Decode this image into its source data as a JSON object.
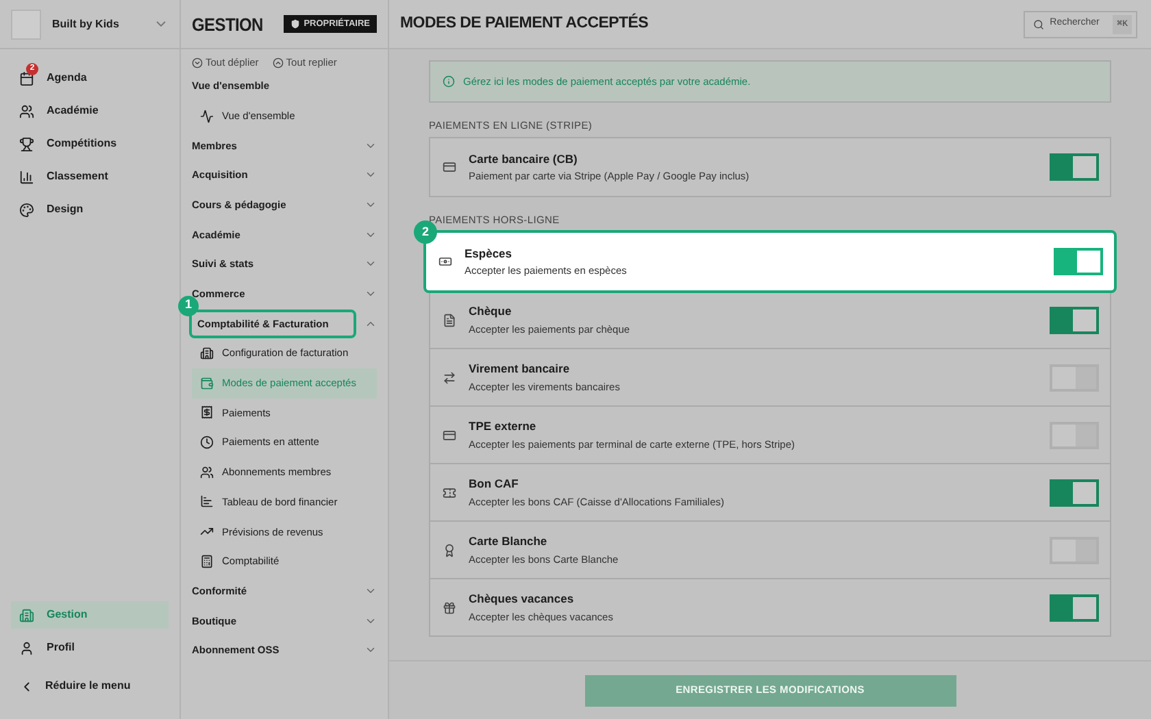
{
  "app_nav": {
    "workspace": "Built by Kids",
    "items": [
      {
        "label": "Agenda",
        "badge": "2",
        "selected": false
      },
      {
        "label": "Académie",
        "selected": false
      },
      {
        "label": "Compétitions",
        "selected": false
      },
      {
        "label": "Classement",
        "selected": false
      },
      {
        "label": "Design",
        "selected": false
      }
    ],
    "bottom_items": [
      {
        "label": "Gestion",
        "selected": true
      },
      {
        "label": "Profil",
        "selected": false
      }
    ],
    "collapse": "Réduire le menu"
  },
  "section_nav": {
    "title": "GESTION",
    "role_badge": "PROPRIÉTAIRE",
    "expand_all": "Tout déplier",
    "collapse_all": "Tout replier",
    "groups": [
      {
        "kind": "section",
        "label": "Vue d'ensemble",
        "children": [
          {
            "label": "Vue d'ensemble",
            "selected": false
          }
        ]
      },
      {
        "kind": "group",
        "label": "Membres",
        "expanded": false
      },
      {
        "kind": "group",
        "label": "Acquisition",
        "expanded": false
      },
      {
        "kind": "group",
        "label": "Cours & pédagogie",
        "expanded": false
      },
      {
        "kind": "group",
        "label": "Académie",
        "expanded": false
      },
      {
        "kind": "group",
        "label": "Suivi & stats",
        "expanded": false
      },
      {
        "kind": "group",
        "label": "Commerce",
        "expanded": false
      },
      {
        "kind": "group",
        "label": "Comptabilité & Facturation",
        "expanded": true,
        "tour_step": "1",
        "children": [
          {
            "label": "Configuration de facturation",
            "selected": false
          },
          {
            "label": "Modes de paiement acceptés",
            "selected": true
          },
          {
            "label": "Paiements",
            "selected": false
          },
          {
            "label": "Paiements en attente",
            "selected": false
          },
          {
            "label": "Abonnements membres",
            "selected": false
          },
          {
            "label": "Tableau de bord financier",
            "selected": false
          },
          {
            "label": "Prévisions de revenus",
            "selected": false
          },
          {
            "label": "Comptabilité",
            "selected": false
          }
        ]
      },
      {
        "kind": "group",
        "label": "Conformité",
        "expanded": false
      },
      {
        "kind": "group",
        "label": "Boutique",
        "expanded": false
      },
      {
        "kind": "group",
        "label": "Abonnement OSS",
        "expanded": false
      }
    ]
  },
  "header": {
    "title": "MODES DE PAIEMENT ACCEPTÉS",
    "search": {
      "placeholder": "Rechercher",
      "shortcut": "⌘K"
    }
  },
  "info": "Gérez ici les modes de paiement acceptés par votre académie.",
  "sections": [
    {
      "title": "PAIEMENTS EN LIGNE (STRIPE)",
      "methods": [
        {
          "name": "Carte bancaire (CB)",
          "description": "Paiement par carte via Stripe (Apple Pay / Google Pay inclus)",
          "on": true
        }
      ]
    },
    {
      "title": "PAIEMENTS HORS-LIGNE",
      "methods": [
        {
          "name": "Espèces",
          "description": "Accepter les paiements en espèces",
          "on": true,
          "tour_step": "2"
        },
        {
          "name": "Chèque",
          "description": "Accepter les paiements par chèque",
          "on": true
        },
        {
          "name": "Virement bancaire",
          "description": "Accepter les virements bancaires",
          "on": false
        },
        {
          "name": "TPE externe",
          "description": "Accepter les paiements par terminal de carte externe (TPE, hors Stripe)",
          "on": false
        },
        {
          "name": "Bon CAF",
          "description": "Accepter les bons CAF (Caisse d'Allocations Familiales)",
          "on": true
        },
        {
          "name": "Carte Blanche",
          "description": "Accepter les bons Carte Blanche",
          "on": false
        },
        {
          "name": "Chèques vacances",
          "description": "Accepter les chèques vacances",
          "on": true
        }
      ]
    }
  ],
  "save_button": "ENREGISTRER LES MODIFICATIONS"
}
